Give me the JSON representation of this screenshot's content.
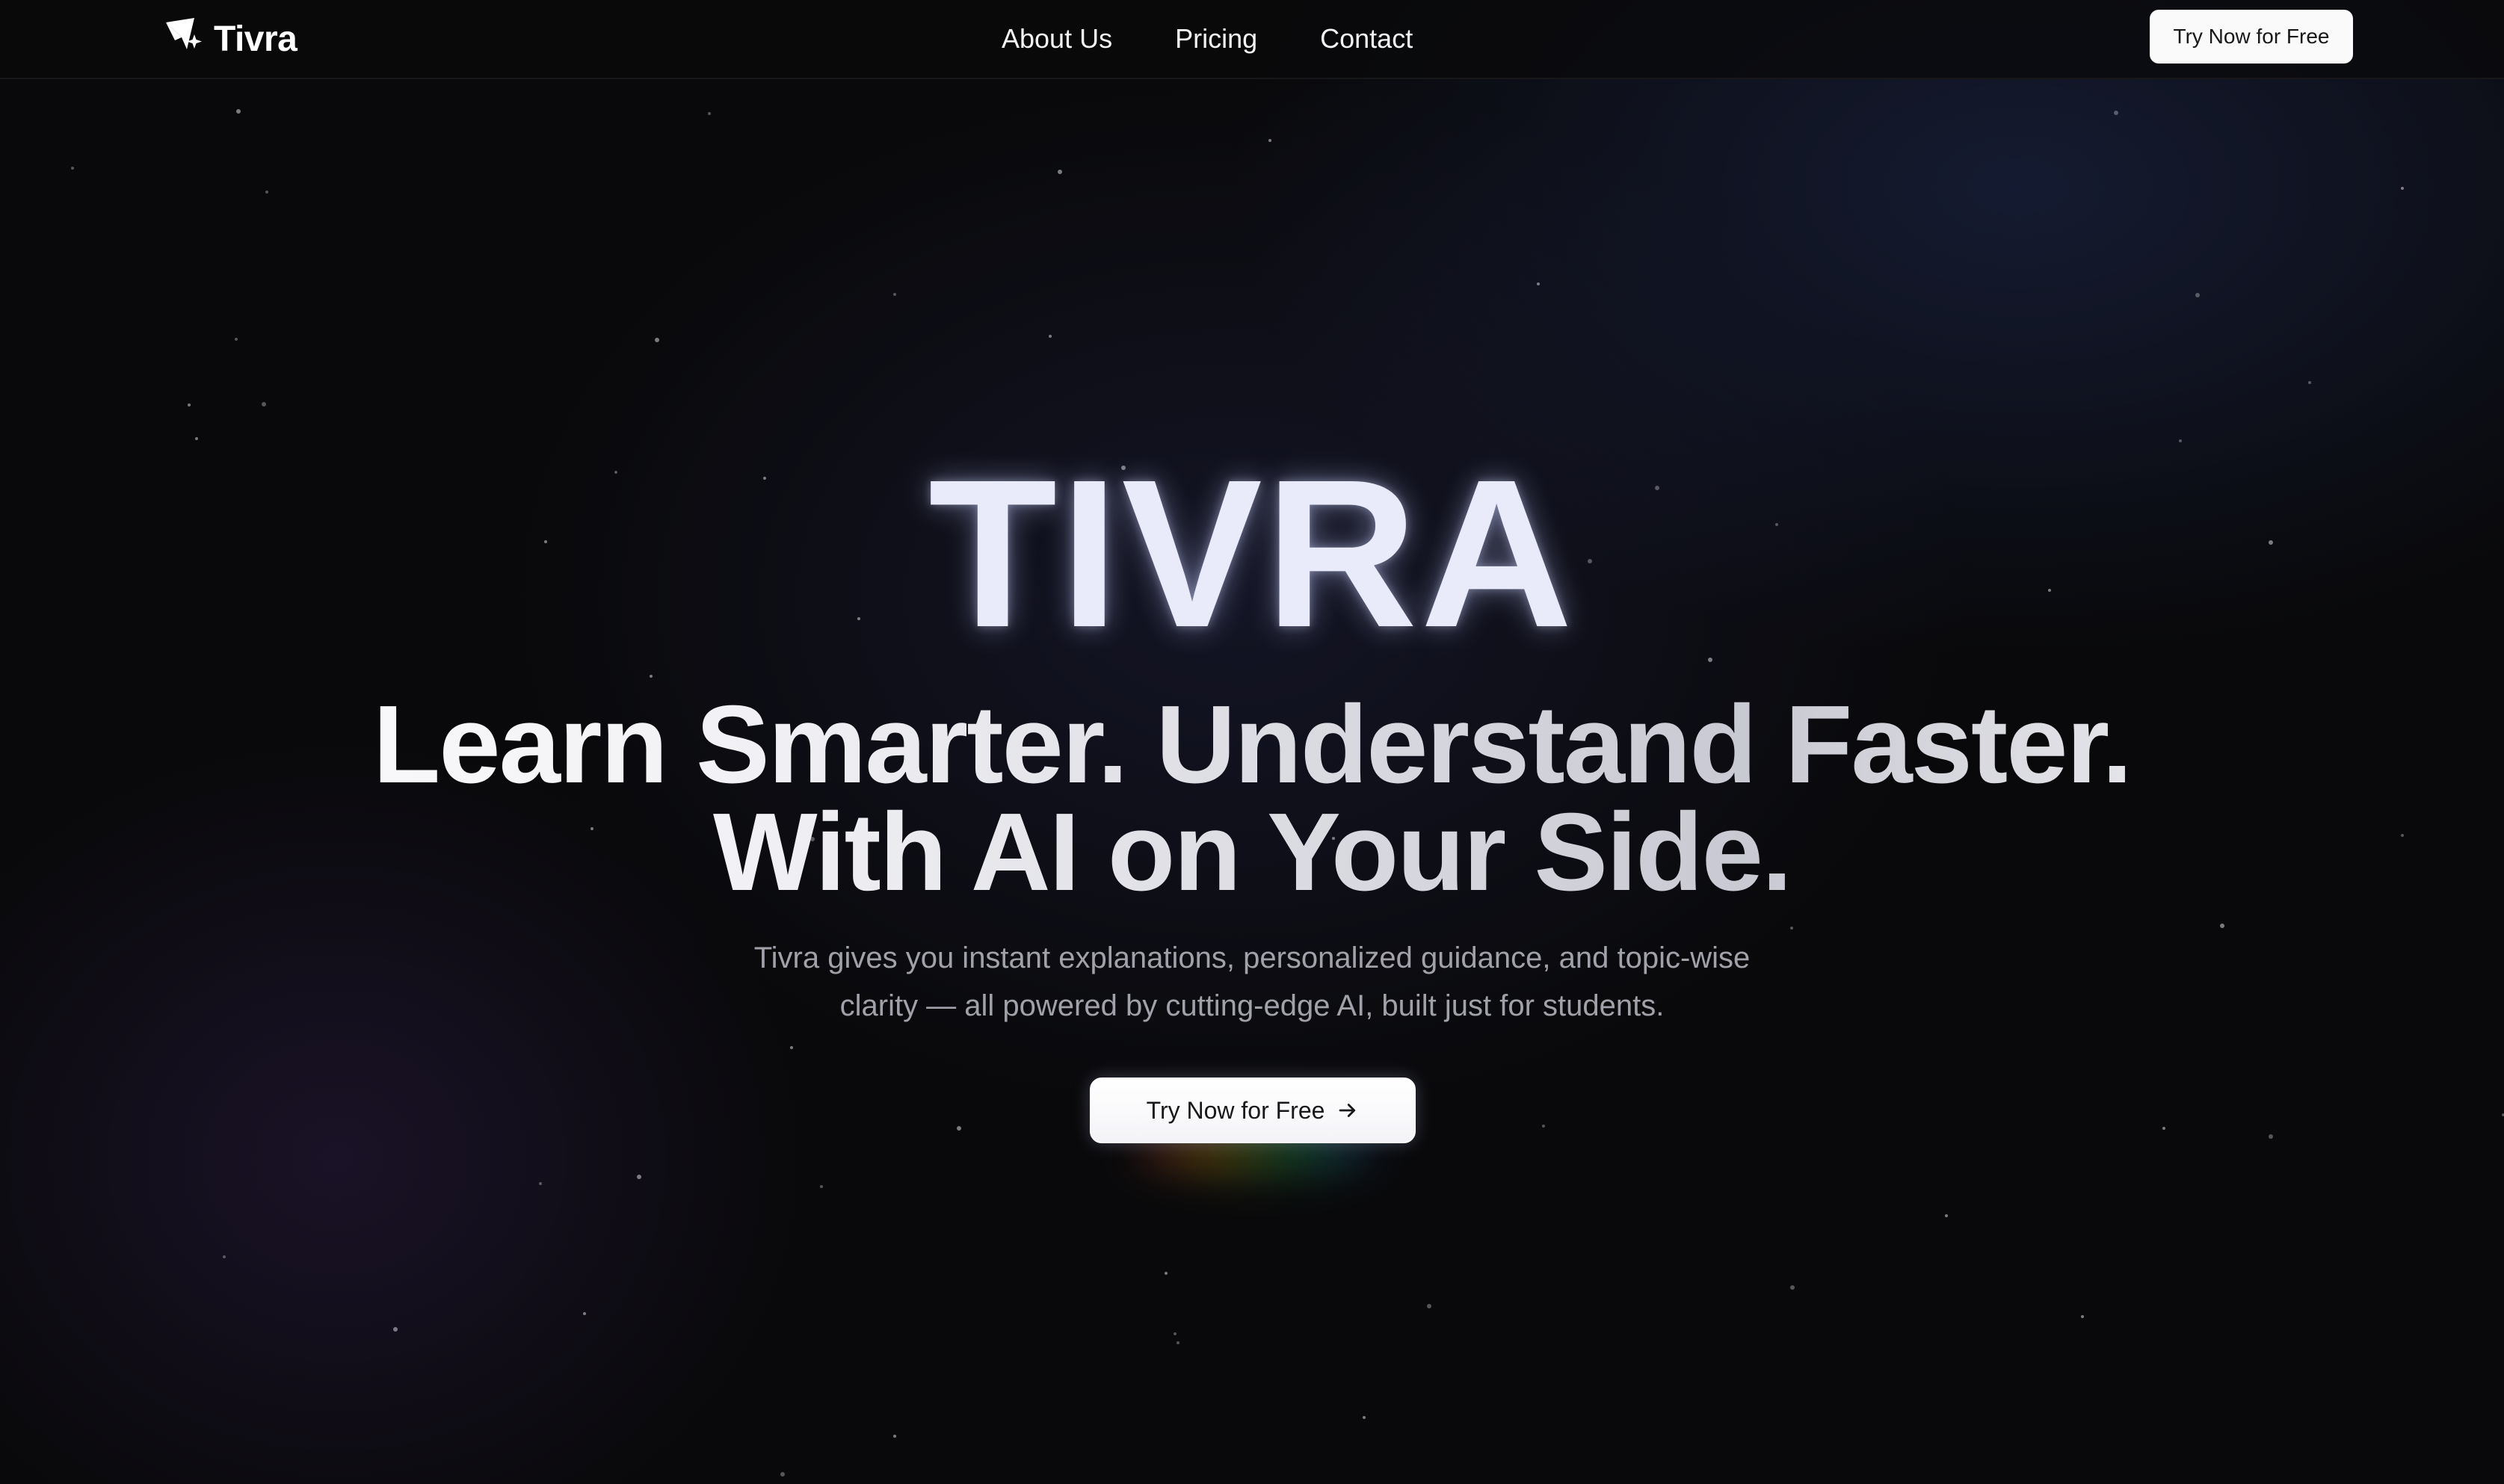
{
  "nav": {
    "logo_text": "Tivra",
    "links": [
      "About Us",
      "Pricing",
      "Contact"
    ],
    "cta_label": "Try Now for Free"
  },
  "hero": {
    "brand": "TIVRA",
    "headline_line1": "Learn Smarter. Understand Faster.",
    "headline_line2": "With AI on Your Side.",
    "description": "Tivra gives you instant explanations, personalized guidance, and topic-wise clarity — all powered by cutting-edge AI, built just for students.",
    "cta_label": "Try Now for Free",
    "cta_icon": "arrow-right-icon"
  },
  "icons": {
    "logo": "sparkle-arrow-logo-icon"
  },
  "colors": {
    "background": "#09090b",
    "text_primary": "#ffffff",
    "text_muted": "#a1a1aa",
    "button_bg": "#fafafa"
  }
}
